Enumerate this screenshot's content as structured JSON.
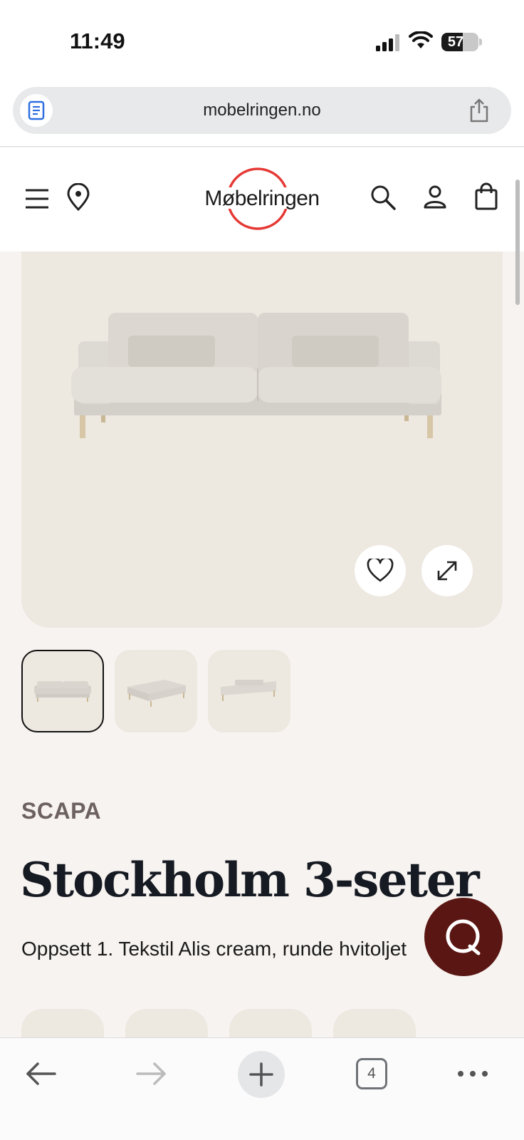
{
  "status_bar": {
    "time": "11:49",
    "battery_level": "57",
    "battery_fraction": 0.57
  },
  "browser": {
    "url": "mobelringen.no",
    "tab_count": "4",
    "icons": {
      "reader": "reader-icon",
      "share": "share-icon",
      "back": "back-arrow-icon",
      "forward": "forward-arrow-icon",
      "new_tab": "plus-icon",
      "tabs": "tabs-icon",
      "more": "more-icon"
    }
  },
  "site_header": {
    "logo_text": "Møbelringen",
    "logo_color": "#e53935",
    "icons": [
      "menu-icon",
      "location-icon",
      "search-icon",
      "account-icon",
      "cart-icon"
    ]
  },
  "product": {
    "brand": "SCAPA",
    "title": "Stockholm 3-seter",
    "description": "Oppsett 1. Tekstil Alis cream, runde hvitoljet",
    "actions": [
      "favorite-icon",
      "expand-icon"
    ],
    "thumbnails": [
      {
        "label": "front-view",
        "selected": true
      },
      {
        "label": "angle-view",
        "selected": false
      },
      {
        "label": "side-view",
        "selected": false
      }
    ]
  },
  "chat": {
    "icon": "chat-icon",
    "color": "#5a1612"
  },
  "colors": {
    "page_background": "#f7f3f0",
    "hero_background": "#ede8e0",
    "brand_text": "#6d625f",
    "title_text": "#161a22"
  }
}
